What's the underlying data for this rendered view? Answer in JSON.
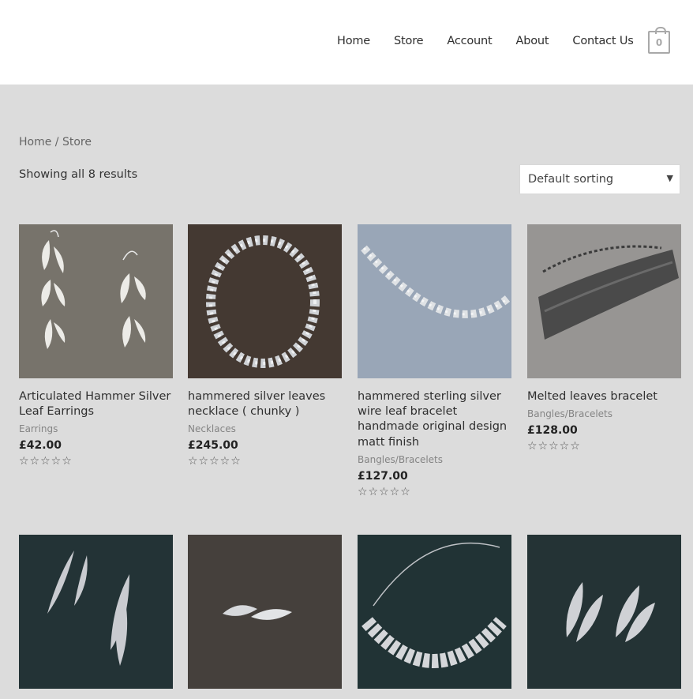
{
  "nav": {
    "items": [
      "Home",
      "Store",
      "Account",
      "About",
      "Contact Us"
    ],
    "cart_count": "0"
  },
  "breadcrumb": {
    "home": "Home",
    "separator": " / ",
    "current": "Store"
  },
  "shop": {
    "result_count": "Showing all 8 results",
    "sorting_label": "Default sorting"
  },
  "products": [
    {
      "title": "Articulated Hammer Silver Leaf Earrings",
      "category": "Earrings",
      "price": "£42.00",
      "rating": "☆☆☆☆☆"
    },
    {
      "title": "hammered silver leaves necklace ( chunky )",
      "category": "Necklaces",
      "price": "£245.00",
      "rating": "☆☆☆☆☆"
    },
    {
      "title": "hammered sterling silver wire leaf bracelet handmade original design matt finish",
      "category": "Bangles/Bracelets",
      "price": "£127.00",
      "rating": "☆☆☆☆☆"
    },
    {
      "title": "Melted leaves bracelet",
      "category": "Bangles/Bracelets",
      "price": "£128.00",
      "rating": "☆☆☆☆☆"
    }
  ],
  "colors": {
    "background": "#dcdcdc",
    "header": "#ffffff",
    "text": "#2f2f2f",
    "muted": "#848484"
  }
}
